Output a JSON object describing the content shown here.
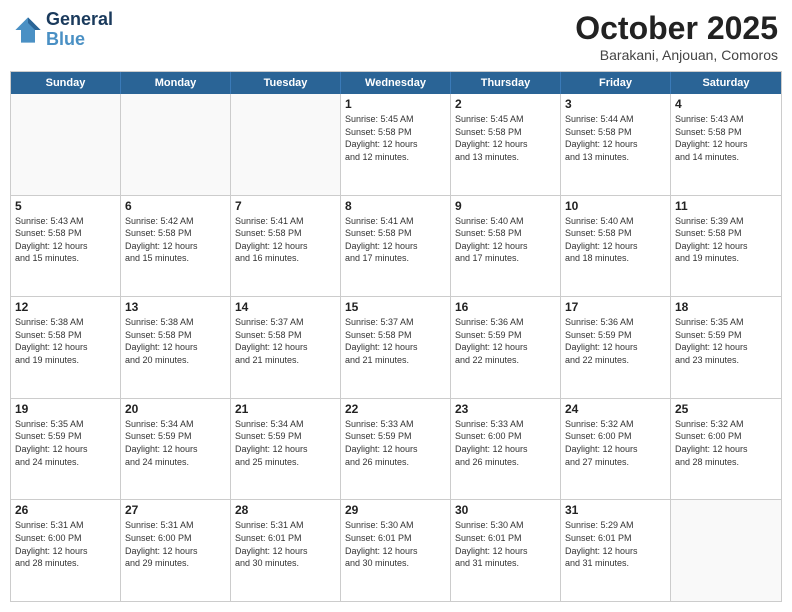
{
  "header": {
    "logo_line1": "General",
    "logo_line2": "Blue",
    "month": "October 2025",
    "location": "Barakani, Anjouan, Comoros"
  },
  "days_of_week": [
    "Sunday",
    "Monday",
    "Tuesday",
    "Wednesday",
    "Thursday",
    "Friday",
    "Saturday"
  ],
  "weeks": [
    [
      {
        "day": "",
        "info": ""
      },
      {
        "day": "",
        "info": ""
      },
      {
        "day": "",
        "info": ""
      },
      {
        "day": "1",
        "info": "Sunrise: 5:45 AM\nSunset: 5:58 PM\nDaylight: 12 hours\nand 12 minutes."
      },
      {
        "day": "2",
        "info": "Sunrise: 5:45 AM\nSunset: 5:58 PM\nDaylight: 12 hours\nand 13 minutes."
      },
      {
        "day": "3",
        "info": "Sunrise: 5:44 AM\nSunset: 5:58 PM\nDaylight: 12 hours\nand 13 minutes."
      },
      {
        "day": "4",
        "info": "Sunrise: 5:43 AM\nSunset: 5:58 PM\nDaylight: 12 hours\nand 14 minutes."
      }
    ],
    [
      {
        "day": "5",
        "info": "Sunrise: 5:43 AM\nSunset: 5:58 PM\nDaylight: 12 hours\nand 15 minutes."
      },
      {
        "day": "6",
        "info": "Sunrise: 5:42 AM\nSunset: 5:58 PM\nDaylight: 12 hours\nand 15 minutes."
      },
      {
        "day": "7",
        "info": "Sunrise: 5:41 AM\nSunset: 5:58 PM\nDaylight: 12 hours\nand 16 minutes."
      },
      {
        "day": "8",
        "info": "Sunrise: 5:41 AM\nSunset: 5:58 PM\nDaylight: 12 hours\nand 17 minutes."
      },
      {
        "day": "9",
        "info": "Sunrise: 5:40 AM\nSunset: 5:58 PM\nDaylight: 12 hours\nand 17 minutes."
      },
      {
        "day": "10",
        "info": "Sunrise: 5:40 AM\nSunset: 5:58 PM\nDaylight: 12 hours\nand 18 minutes."
      },
      {
        "day": "11",
        "info": "Sunrise: 5:39 AM\nSunset: 5:58 PM\nDaylight: 12 hours\nand 19 minutes."
      }
    ],
    [
      {
        "day": "12",
        "info": "Sunrise: 5:38 AM\nSunset: 5:58 PM\nDaylight: 12 hours\nand 19 minutes."
      },
      {
        "day": "13",
        "info": "Sunrise: 5:38 AM\nSunset: 5:58 PM\nDaylight: 12 hours\nand 20 minutes."
      },
      {
        "day": "14",
        "info": "Sunrise: 5:37 AM\nSunset: 5:58 PM\nDaylight: 12 hours\nand 21 minutes."
      },
      {
        "day": "15",
        "info": "Sunrise: 5:37 AM\nSunset: 5:58 PM\nDaylight: 12 hours\nand 21 minutes."
      },
      {
        "day": "16",
        "info": "Sunrise: 5:36 AM\nSunset: 5:59 PM\nDaylight: 12 hours\nand 22 minutes."
      },
      {
        "day": "17",
        "info": "Sunrise: 5:36 AM\nSunset: 5:59 PM\nDaylight: 12 hours\nand 22 minutes."
      },
      {
        "day": "18",
        "info": "Sunrise: 5:35 AM\nSunset: 5:59 PM\nDaylight: 12 hours\nand 23 minutes."
      }
    ],
    [
      {
        "day": "19",
        "info": "Sunrise: 5:35 AM\nSunset: 5:59 PM\nDaylight: 12 hours\nand 24 minutes."
      },
      {
        "day": "20",
        "info": "Sunrise: 5:34 AM\nSunset: 5:59 PM\nDaylight: 12 hours\nand 24 minutes."
      },
      {
        "day": "21",
        "info": "Sunrise: 5:34 AM\nSunset: 5:59 PM\nDaylight: 12 hours\nand 25 minutes."
      },
      {
        "day": "22",
        "info": "Sunrise: 5:33 AM\nSunset: 5:59 PM\nDaylight: 12 hours\nand 26 minutes."
      },
      {
        "day": "23",
        "info": "Sunrise: 5:33 AM\nSunset: 6:00 PM\nDaylight: 12 hours\nand 26 minutes."
      },
      {
        "day": "24",
        "info": "Sunrise: 5:32 AM\nSunset: 6:00 PM\nDaylight: 12 hours\nand 27 minutes."
      },
      {
        "day": "25",
        "info": "Sunrise: 5:32 AM\nSunset: 6:00 PM\nDaylight: 12 hours\nand 28 minutes."
      }
    ],
    [
      {
        "day": "26",
        "info": "Sunrise: 5:31 AM\nSunset: 6:00 PM\nDaylight: 12 hours\nand 28 minutes."
      },
      {
        "day": "27",
        "info": "Sunrise: 5:31 AM\nSunset: 6:00 PM\nDaylight: 12 hours\nand 29 minutes."
      },
      {
        "day": "28",
        "info": "Sunrise: 5:31 AM\nSunset: 6:01 PM\nDaylight: 12 hours\nand 30 minutes."
      },
      {
        "day": "29",
        "info": "Sunrise: 5:30 AM\nSunset: 6:01 PM\nDaylight: 12 hours\nand 30 minutes."
      },
      {
        "day": "30",
        "info": "Sunrise: 5:30 AM\nSunset: 6:01 PM\nDaylight: 12 hours\nand 31 minutes."
      },
      {
        "day": "31",
        "info": "Sunrise: 5:29 AM\nSunset: 6:01 PM\nDaylight: 12 hours\nand 31 minutes."
      },
      {
        "day": "",
        "info": ""
      }
    ]
  ]
}
